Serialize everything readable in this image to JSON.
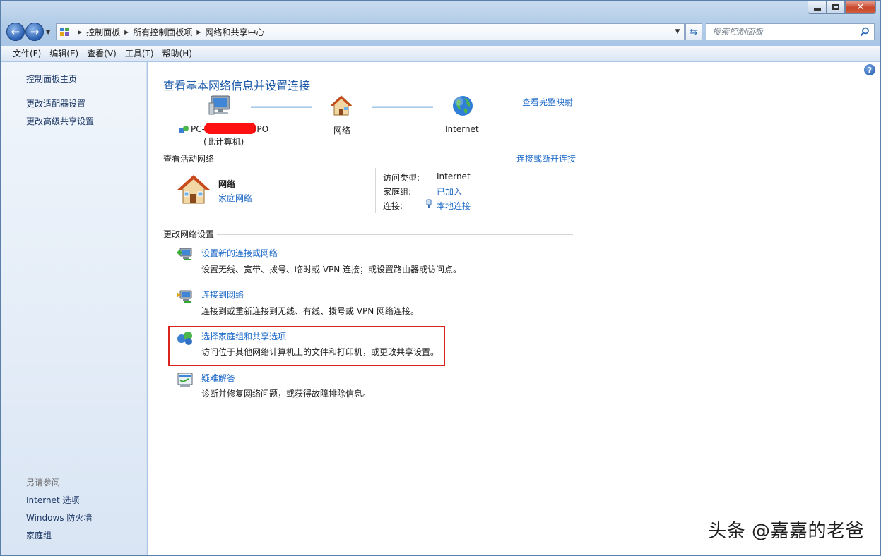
{
  "window": {
    "caption": {
      "minimize": "",
      "maximize": "",
      "close": "✕"
    }
  },
  "address_bar": {
    "breadcrumbs": [
      "控制面板",
      "所有控制面板项",
      "网络和共享中心"
    ],
    "search_placeholder": "搜索控制面板"
  },
  "menu": [
    "文件(F)",
    "编辑(E)",
    "查看(V)",
    "工具(T)",
    "帮助(H)"
  ],
  "sidebar": {
    "links": [
      "控制面板主页",
      "更改适配器设置",
      "更改高级共享设置"
    ],
    "see_also_heading": "另请参阅",
    "see_also": [
      "Internet 选项",
      "Windows 防火墙",
      "家庭组"
    ]
  },
  "main": {
    "title": "查看基本网络信息并设置连接",
    "view_full_map": "查看完整映射",
    "map": {
      "computer_name_prefix": "PC-",
      "computer_name_suffix": "TPO",
      "computer_sub": "(此计算机)",
      "network": "网络",
      "internet": "Internet"
    },
    "active_networks": {
      "heading": "查看活动网络",
      "connect_link": "连接或断开连接",
      "network_name": "网络",
      "network_type": "家庭网络",
      "access_type_label": "访问类型:",
      "access_type_value": "Internet",
      "homegroup_label": "家庭组:",
      "homegroup_value": "已加入",
      "connection_label": "连接:",
      "connection_value": "本地连接"
    },
    "change_settings": {
      "heading": "更改网络设置",
      "tasks": [
        {
          "title": "设置新的连接或网络",
          "desc": "设置无线、宽带、拨号、临时或 VPN 连接；或设置路由器或访问点。"
        },
        {
          "title": "连接到网络",
          "desc": "连接到或重新连接到无线、有线、拨号或 VPN 网络连接。"
        },
        {
          "title": "选择家庭组和共享选项",
          "desc": "访问位于其他网络计算机上的文件和打印机，或更改共享设置。"
        },
        {
          "title": "疑难解答",
          "desc": "诊断并修复网络问题，或获得故障排除信息。"
        }
      ]
    }
  },
  "watermark": "头条 @嘉嘉的老爸",
  "colors": {
    "link": "#1e6ac8",
    "title": "#1e5aa8",
    "highlight": "#d9241b"
  }
}
